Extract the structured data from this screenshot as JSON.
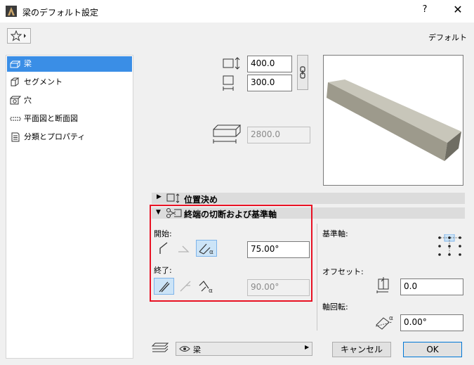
{
  "window": {
    "title": "梁のデフォルト設定",
    "help": "?",
    "close": "✕"
  },
  "toolbar": {
    "default_label": "デフォルト"
  },
  "sidebar": {
    "items": [
      {
        "label": "梁",
        "icon": "beam-icon",
        "selected": true
      },
      {
        "label": "セグメント",
        "icon": "segment-icon",
        "selected": false
      },
      {
        "label": "穴",
        "icon": "hole-icon",
        "selected": false
      },
      {
        "label": "平面図と断面図",
        "icon": "plan-section-icon",
        "selected": false
      },
      {
        "label": "分類とプロパティ",
        "icon": "classification-icon",
        "selected": false
      }
    ]
  },
  "dimensions": {
    "height": "400.0",
    "width": "300.0",
    "length": "2800.0"
  },
  "sections": {
    "positioning": {
      "title": "位置決め",
      "expanded": false
    },
    "end_cuts": {
      "title": "終端の切断および基準軸",
      "expanded": true
    }
  },
  "end_cuts": {
    "start_label": "開始:",
    "start_angle": "75.00°",
    "end_label": "終了:",
    "end_angle": "90.00°"
  },
  "reference_axis": {
    "label": "基準軸:",
    "offset_label": "オフセット:",
    "offset_value": "0.0",
    "rotation_label": "軸回転:",
    "rotation_value": "0.00°"
  },
  "footer": {
    "layer": "梁",
    "cancel": "キャンセル",
    "ok": "OK"
  },
  "colors": {
    "selection": "#3a8ee6",
    "highlight_box": "#e81123",
    "active_tool": "#cce4f7"
  }
}
